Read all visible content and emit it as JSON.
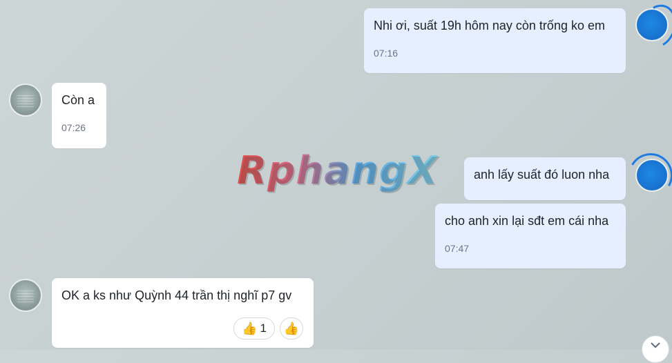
{
  "messages": [
    {
      "text": "Nhi ơi, suất 19h hôm nay còn trống ko em",
      "time": "07:16"
    },
    {
      "text": "Còn a",
      "time": "07:26"
    },
    {
      "text": "anh lấy suất đó luon nha"
    },
    {
      "text": "cho anh xin lại sđt em cái nha",
      "time": "07:47"
    },
    {
      "text": "OK a ks như Quỳnh 44 trần thị nghĩ p7 gv"
    }
  ],
  "reactions": {
    "count_emoji": "👍",
    "count": "1",
    "add_emoji": "👍"
  },
  "watermark": "RphangX",
  "icons": {
    "scroll_down": "chevron-down-icon",
    "thumbs_up": "thumbs-up-icon"
  },
  "colors": {
    "outgoing_bubble": "#e6efff",
    "incoming_bubble": "#ffffff",
    "background": "#c8d1d2",
    "avatar_out": "#1976d2"
  }
}
